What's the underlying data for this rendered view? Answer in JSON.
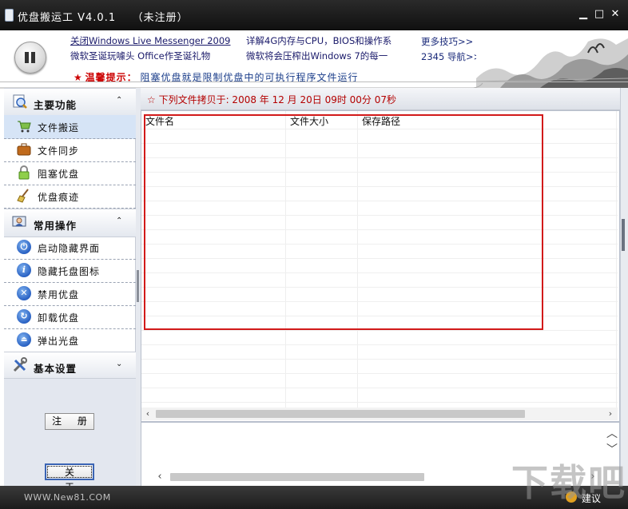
{
  "window": {
    "title": "优盘搬运工 V4.0.1    （未注册）",
    "minimize_glyph": "▁",
    "maximize_glyph": "□",
    "close_glyph": "✕"
  },
  "banner": {
    "news": [
      "关闭Windows Live Messenger 2009",
      "微软圣诞玩噱头 Office作圣诞礼物",
      "详解4G内存与CPU，BIOS和操作系",
      "微软将会压榨出Windows 7的每一"
    ],
    "more_tips": "更多技巧>>",
    "nav_2345": "2345 导航>>",
    "tip_label": "温馨提示：",
    "tip_text": "阻塞优盘就是限制优盘中的可执行程序文件运行"
  },
  "sidebar": {
    "sections": [
      {
        "label": "主要功能",
        "chevron": "⌃",
        "items": [
          {
            "label": "文件搬运",
            "icon": "cart-icon"
          },
          {
            "label": "文件同步",
            "icon": "briefcase-icon"
          },
          {
            "label": "阻塞优盘",
            "icon": "lock-icon"
          },
          {
            "label": "优盘痕迹",
            "icon": "broom-icon"
          }
        ]
      },
      {
        "label": "常用操作",
        "chevron": "⌃",
        "items": [
          {
            "label": "启动隐藏界面",
            "icon": "power-icon"
          },
          {
            "label": "隐藏托盘图标",
            "icon": "info-icon"
          },
          {
            "label": "禁用优盘",
            "icon": "close-circle-icon"
          },
          {
            "label": "卸载优盘",
            "icon": "refresh-icon"
          },
          {
            "label": "弹出光盘",
            "icon": "eject-icon"
          }
        ]
      },
      {
        "label": "基本设置",
        "chevron": "⌄",
        "items": []
      }
    ],
    "register_button": "注 册",
    "about_button": "关 于"
  },
  "main": {
    "copy_header": "☆ 下列文件拷贝于:  2008 年 12 月 20日 09时 00分 07秒",
    "columns": [
      "文件名",
      "文件大小",
      "保存路径"
    ],
    "rows": []
  },
  "statusbar": {
    "site": "WWW.New81.COM",
    "suggest": "建议"
  },
  "colors": {
    "titlebar": "#1a1a1a",
    "accent_red": "#d21a1a",
    "link_blue": "#1a3d8a",
    "selected_item": "#d6e4f6"
  }
}
